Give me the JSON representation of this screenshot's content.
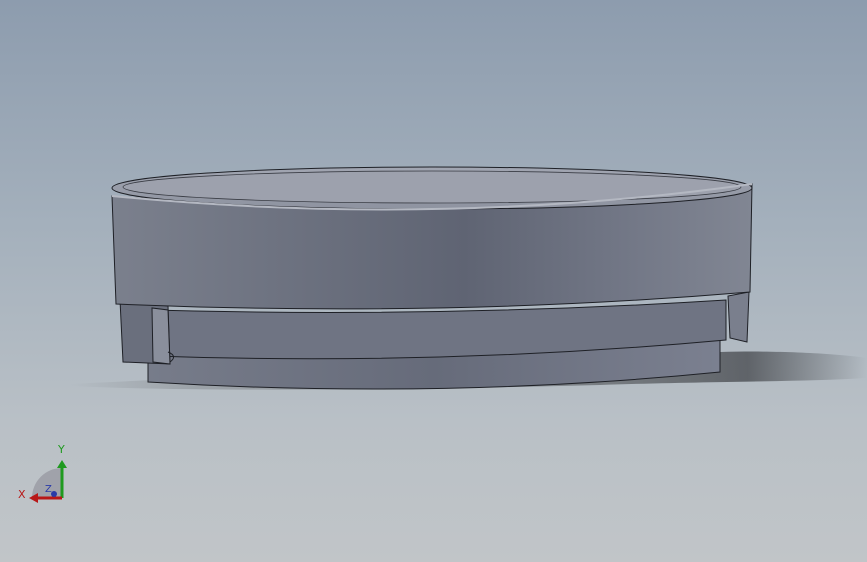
{
  "viewport": {
    "background_top": "#8d9cae",
    "background_bottom": "#c1c5c8",
    "model_color": "#6c7180"
  },
  "triad": {
    "x_label": "X",
    "y_label": "Y",
    "z_label": "Z",
    "x_color": "#b81818",
    "y_color": "#1f9a1f",
    "z_color": "#2a3aa8"
  }
}
